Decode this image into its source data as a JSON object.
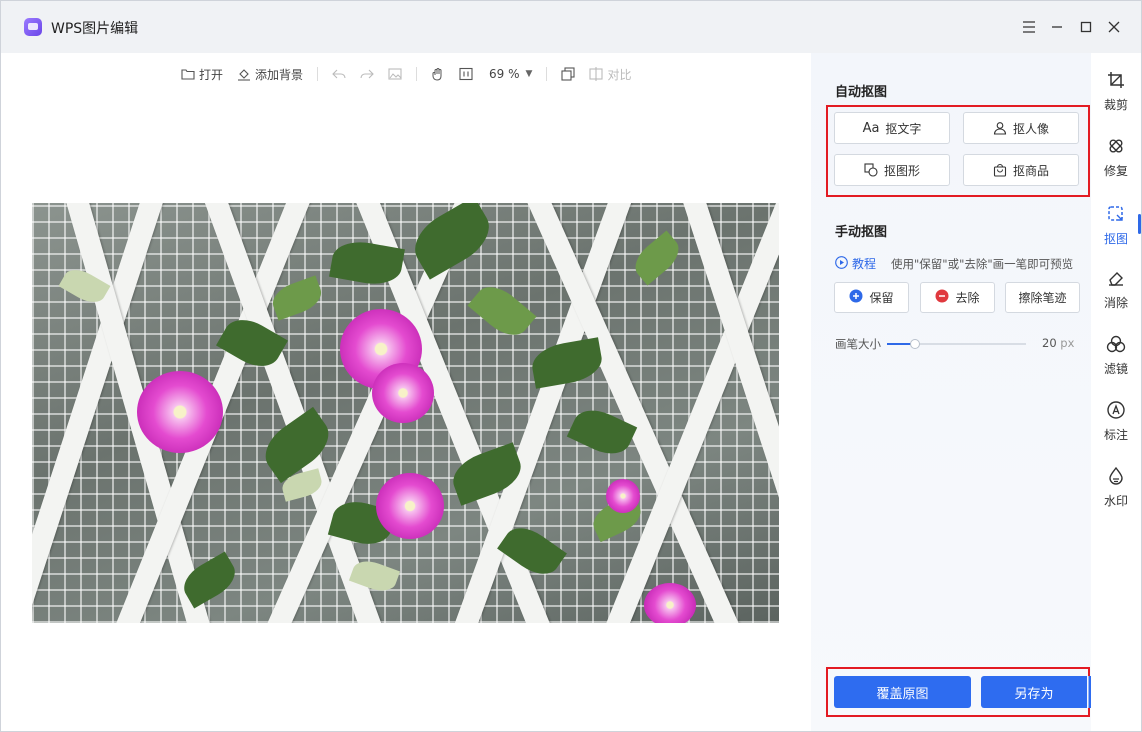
{
  "window": {
    "title": "WPS图片编辑"
  },
  "toolbar": {
    "open_label": "打开",
    "add_background_label": "添加背景",
    "zoom_value": "69 %",
    "compare_label": "对比"
  },
  "auto_cutout": {
    "title": "自动抠图",
    "buttons": [
      {
        "label": "抠文字",
        "icon": "text-aa-icon"
      },
      {
        "label": "抠人像",
        "icon": "person-icon"
      },
      {
        "label": "抠图形",
        "icon": "shape-icon"
      },
      {
        "label": "抠商品",
        "icon": "bag-icon"
      }
    ]
  },
  "manual_cutout": {
    "title": "手动抠图",
    "tutorial_label": "教程",
    "hint": "使用\"保留\"或\"去除\"画一笔即可预览",
    "keep_label": "保留",
    "remove_label": "去除",
    "erase_label": "擦除笔迹",
    "brush_label": "画笔大小",
    "brush_value": "20",
    "brush_unit": "px",
    "brush_level": 0.2
  },
  "actions": {
    "overwrite_label": "覆盖原图",
    "save_as_label": "另存为"
  },
  "rail": {
    "items": [
      {
        "label": "裁剪",
        "icon": "crop-icon"
      },
      {
        "label": "修复",
        "icon": "bandage-icon"
      },
      {
        "label": "抠图",
        "icon": "cutout-icon",
        "active": true
      },
      {
        "label": "消除",
        "icon": "eraser-icon"
      },
      {
        "label": "滤镜",
        "icon": "filter-icon"
      },
      {
        "label": "标注",
        "icon": "annotate-icon"
      },
      {
        "label": "水印",
        "icon": "watermark-icon"
      }
    ]
  },
  "colors": {
    "accent": "#2e69e8",
    "primary_button": "#2e6cf0",
    "highlight_box": "#e31b23"
  }
}
